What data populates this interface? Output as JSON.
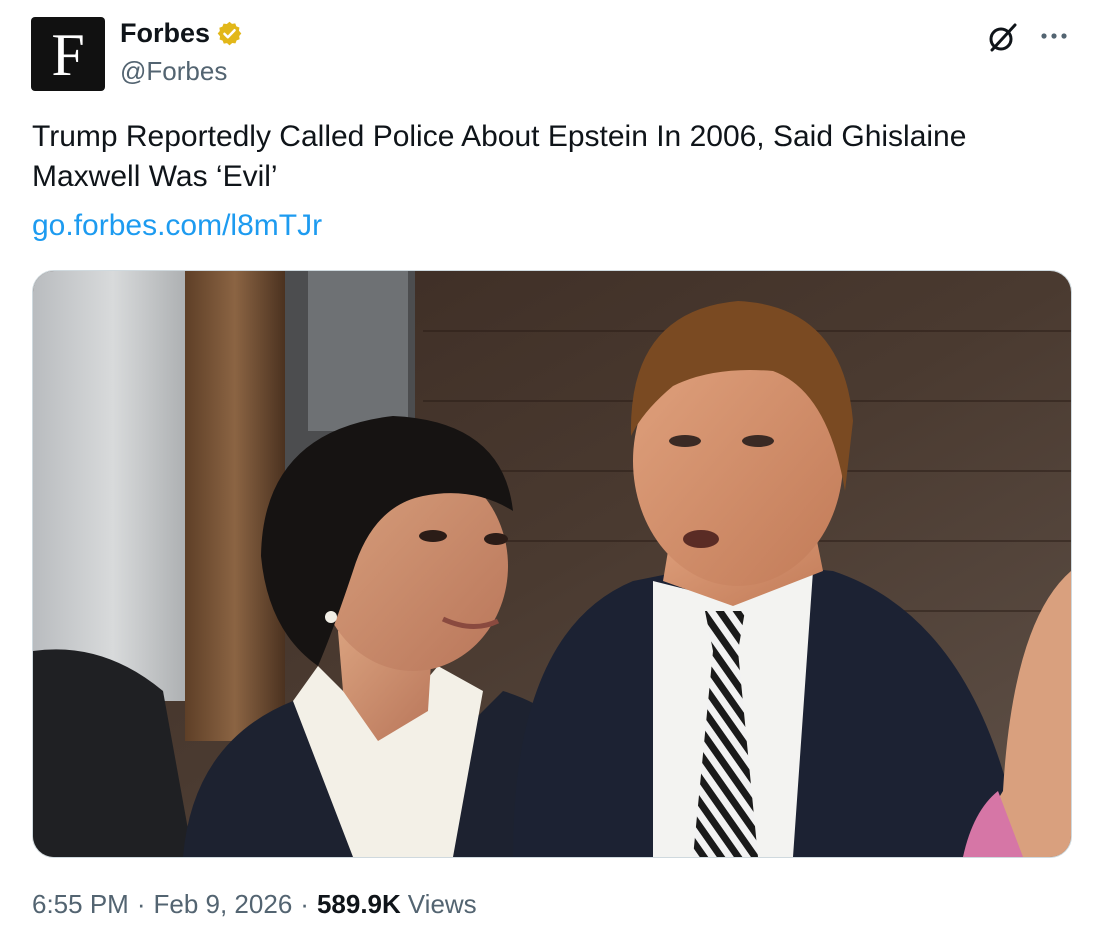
{
  "author": {
    "display_name": "Forbes",
    "handle": "@Forbes",
    "avatar_letter": "F",
    "verified_badge": "gold-verified-badge-icon",
    "verified_color": "#e2b719"
  },
  "header_actions": {
    "grok_icon": "grok-icon",
    "more_icon": "more-horizontal-icon"
  },
  "tweet": {
    "text": "Trump Reportedly Called Police About Epstein In 2006, Said Ghislaine Maxwell Was ‘Evil’",
    "link": "go.forbes.com/l8mTJr"
  },
  "media": {
    "kind": "photo"
  },
  "meta": {
    "time": "6:55 PM",
    "separator": "·",
    "date": "Feb 9, 2026",
    "views_count": "589.9K",
    "views_label": "Views"
  },
  "colors": {
    "text_primary": "#0f1419",
    "text_secondary": "#536471",
    "link": "#1d9bf0",
    "border": "#cfd9de"
  }
}
